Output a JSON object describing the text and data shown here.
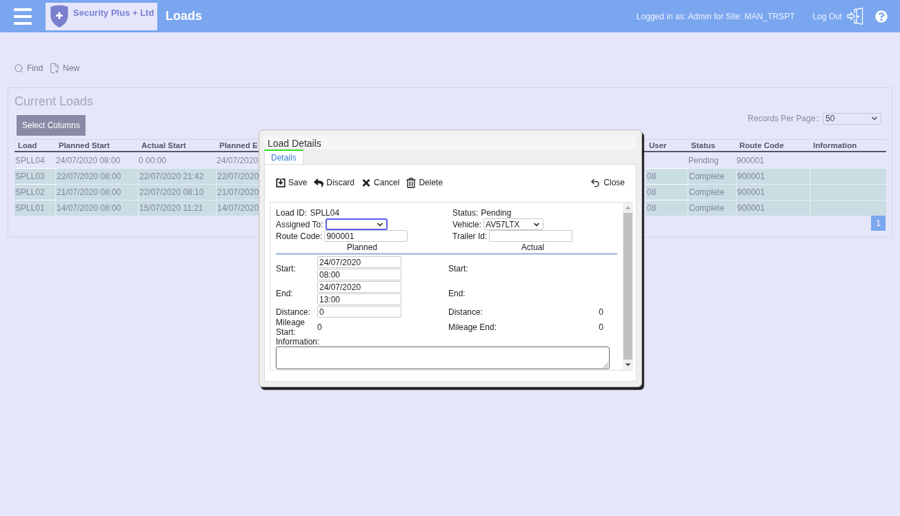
{
  "header": {
    "logo_name": "Security Plus + Ltd",
    "title": "Loads",
    "user_info": "Logged in as: Admin for Site: MAN_TRSPT",
    "logout": "Log Out"
  },
  "toolbar": [
    {
      "kind": "find",
      "label": "Find"
    },
    {
      "kind": "new",
      "label": "New"
    }
  ],
  "panel": {
    "title": "Current Loads",
    "select_columns": "Select Columns",
    "records_per_page": {
      "label": "Records Per Page::",
      "value": "50"
    },
    "table": {
      "columns": [
        "Load",
        "Planned Start",
        "Actual Start",
        "Planned E",
        "User",
        "Status",
        "Route Code",
        "Information"
      ],
      "rows": [
        {
          "highlighted": false,
          "cells": [
            "SPLL04",
            "24/07/2020 08:00",
            "0 00:00",
            "24/07/2020",
            null,
            "Pending",
            "900001",
            null
          ]
        },
        {
          "highlighted": true,
          "cells": [
            "SPLL03",
            "22/07/2020 08:00",
            "22/07/2020 21:42",
            "22/07/2020",
            "08",
            "Complete",
            "900001",
            null
          ]
        },
        {
          "highlighted": true,
          "cells": [
            "SPLL02",
            "21/07/2020 08:00",
            "22/07/2020 08:10",
            "21/07/2020",
            "08",
            "Complete",
            "900001",
            null
          ]
        },
        {
          "highlighted": true,
          "cells": [
            "SPLL01",
            "14/07/2020 08:00",
            "15/07/2020 11:21",
            "14/07/2020",
            "08",
            "Complete",
            "900001",
            null
          ]
        }
      ]
    },
    "pagination": [
      {
        "label": "1",
        "selected": true
      }
    ]
  },
  "dialog": {
    "title": "Load Details",
    "tabs": [
      {
        "label": "Details",
        "selected": true
      }
    ],
    "actions": [
      {
        "kind": "save",
        "label": "Save"
      },
      {
        "kind": "discard",
        "label": "Discard"
      },
      {
        "kind": "cancel",
        "label": "Cancel"
      },
      {
        "kind": "delete",
        "label": "Delete"
      },
      {
        "kind": "close",
        "label": "Close"
      }
    ],
    "form": {
      "load_id": {
        "label": "Load ID:",
        "value": "SPLL04"
      },
      "status": {
        "label": "Status:",
        "value": "Pending"
      },
      "assigned_to": {
        "label": "Assigned To:",
        "focused": true
      },
      "vehicle": {
        "label": "Vehicle:",
        "value": "AV57LTX",
        "focused": false
      },
      "route_code": {
        "label": "Route Code:",
        "value": "900001"
      },
      "trailer_id": {
        "label": "Trailer Id:"
      },
      "planned": {
        "heading": "Planned",
        "start": {
          "label": "Start:",
          "date": "24/07/2020",
          "time": "08:00"
        },
        "end": {
          "label": "End:",
          "date": "24/07/2020",
          "time": "13:00"
        },
        "distance": {
          "label": "Distance:",
          "value": "0"
        },
        "mileage_start": {
          "label": "Mileage Start:",
          "value": "0"
        }
      },
      "actual": {
        "heading": "Actual",
        "start": {
          "label": "Start:"
        },
        "end": {
          "label": "End:"
        },
        "distance": {
          "label": "Distance:",
          "value": "0"
        },
        "mileage_end": {
          "label": "Mileage End:",
          "value": "0"
        }
      },
      "information": {
        "label": "Information:"
      }
    }
  }
}
